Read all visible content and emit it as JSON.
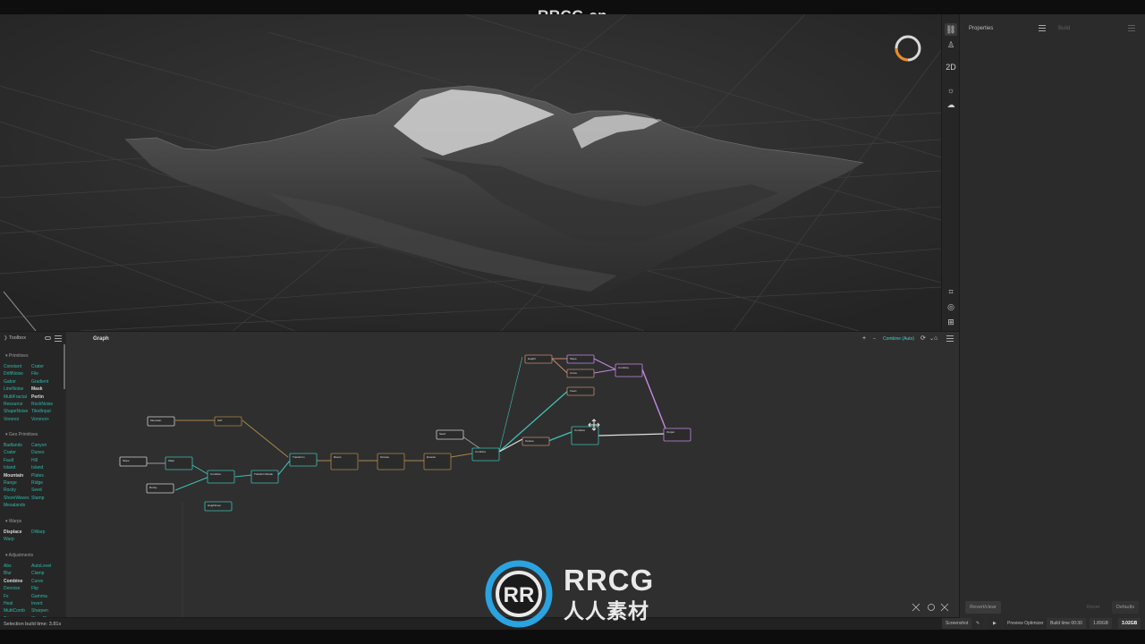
{
  "watermark": {
    "top_text": "RRCG.cn",
    "logo_text": "RRCG",
    "logo_subtext": "人人素材"
  },
  "viewport": {
    "toolbar": [
      "link-icon",
      "person-icon",
      "2D",
      "sun-icon",
      "cloud-icon",
      "frame-icon",
      "compass-icon",
      "grid-icon"
    ],
    "toolbar_2d_label": "2D"
  },
  "properties": {
    "tab_properties": "Properties",
    "tab_build": "Build",
    "revert_button": "Revert/clear",
    "reset_button": "Reset",
    "defaults_button": "Defaults"
  },
  "toolbox": {
    "title": "Toolbox",
    "sections": [
      {
        "name": "Primitives",
        "items": [
          [
            "Constant",
            "Crater"
          ],
          [
            "DriftNoise",
            "File"
          ],
          [
            "Gabor",
            "Gradient"
          ],
          [
            "LineNoise",
            "Mask"
          ],
          [
            "MultiFractal",
            "Perlin"
          ],
          [
            "Resource",
            "RockNoise"
          ],
          [
            "ShapeNoise",
            "TiledInput"
          ],
          [
            "Voronoi",
            "Voronoi+"
          ]
        ]
      },
      {
        "name": "Geo Primitives",
        "items": [
          [
            "Badlands",
            "Canyon"
          ],
          [
            "Crater",
            "Dunes"
          ],
          [
            "Fault",
            "Hill"
          ],
          [
            "Island",
            "Island"
          ],
          [
            "Mountain",
            "Plates"
          ],
          [
            "Range",
            "Ridge"
          ],
          [
            "Rocky",
            "Seed"
          ],
          [
            "ShoreWaves",
            "Stamp"
          ],
          [
            "Mesalands",
            ""
          ]
        ]
      },
      {
        "name": "Warps",
        "items": [
          [
            "Displace",
            "DWarp"
          ],
          [
            "Warp",
            ""
          ]
        ]
      },
      {
        "name": "Adjustments",
        "items": [
          [
            "Abs",
            "AutoLevel"
          ],
          [
            "Blur",
            "Clamp"
          ],
          [
            "Combine",
            "Curve"
          ],
          [
            "Denoise",
            "Flip"
          ],
          [
            "Fx",
            "Gamma"
          ],
          [
            "Heal",
            "Invert"
          ],
          [
            "MultiComb",
            "Sharpen"
          ],
          [
            "Trim",
            "SlopeBlur"
          ]
        ]
      }
    ]
  },
  "graph": {
    "title": "Graph",
    "add_label": "+",
    "combine_label": "Combine (Auto)",
    "node_labels": {
      "n1": "Mountain",
      "n2": "SAT",
      "n3": "Slope",
      "n4": "Warp",
      "n5": "Combine",
      "n6": "TransformScale",
      "n7": "Rocky",
      "n8": "Heightmap",
      "n9": "Transform",
      "n10": "Rivers",
      "n11": "Terrace",
      "n12": "Erosion",
      "n13": "Seed",
      "n14": "Combine",
      "n15": "Height",
      "n16": "Slope",
      "n17": "Curve",
      "n18": "Combine",
      "n19": "Invert",
      "n20": "Output",
      "n21": "Texture",
      "n22": "Combine",
      "n23": "Output"
    }
  },
  "status": {
    "selection_build_time": "Selection build time: 3.81s",
    "screenshot": "Screenshot",
    "preview_optimizer": "Preview Optimizer",
    "build_time": "Build time 00:30",
    "resolution": "1.89GB",
    "memory": "3.02GB"
  }
}
